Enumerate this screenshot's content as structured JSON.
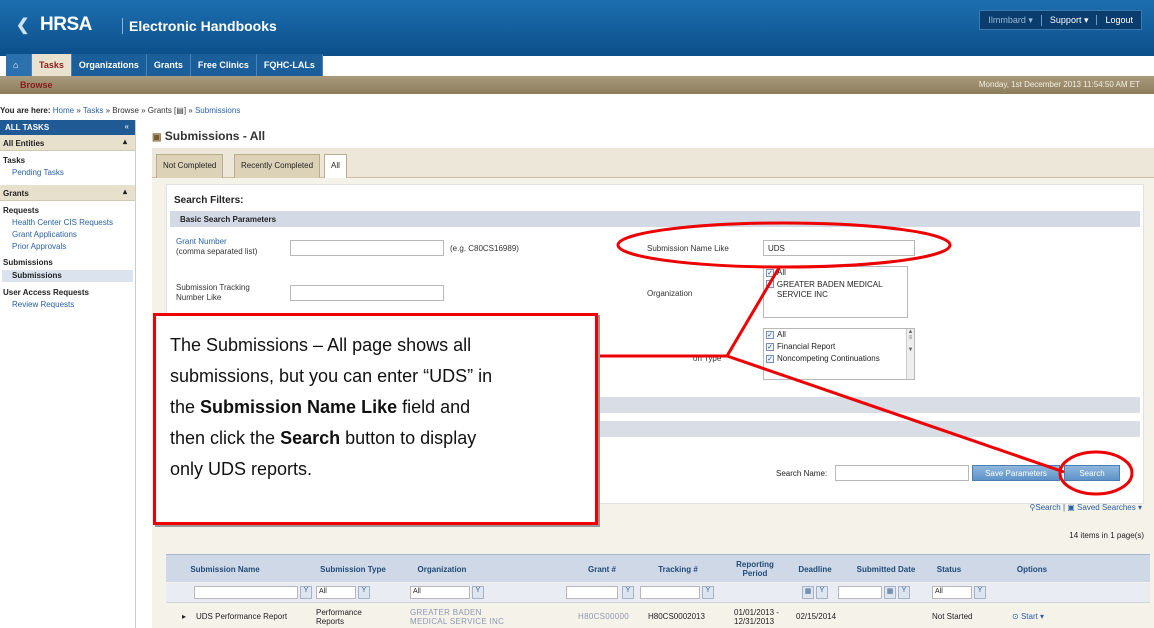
{
  "header": {
    "logo_text": "HRSA",
    "app_title": "Electronic Handbooks",
    "user_menu": "Ilmmbard ▾",
    "support": "Support ▾",
    "logout": "Logout",
    "nav_tabs": [
      "Tasks",
      "Organizations",
      "Grants",
      "Free Clinics",
      "FQHC-LALs"
    ],
    "subnav": "Browse",
    "datetime": "Monday, 1st December 2013 11:54:50 AM ET"
  },
  "breadcrumb": {
    "prefix": "You are here:",
    "home": "Home",
    "tasks": "Tasks",
    "rest": "» Browse » Grants [",
    "after": "] »",
    "submissions": "Submissions"
  },
  "sidebar": {
    "title": "ALL TASKS",
    "collapse": "«",
    "all_entities": "All Entities",
    "tasks_group": "Tasks",
    "pending_tasks": "Pending Tasks",
    "grants": "Grants",
    "requests_group": "Requests",
    "hc_cis": "Health Center CIS Requests",
    "grant_apps": "Grant Applications",
    "prior_approvals": "Prior Approvals",
    "submissions_group": "Submissions",
    "submissions_item": "Submissions",
    "user_access_group": "User Access Requests",
    "review_requests": "Review Requests"
  },
  "main": {
    "title": "Submissions - All",
    "tabs": [
      "Not Completed",
      "Recently Completed",
      "All"
    ],
    "filters_title": "Search Filters:",
    "basic_header": "Basic Search Parameters",
    "grant_number_label": "Grant Number",
    "grant_number_hint": "(comma separated list)",
    "grant_number_example": "(e.g. C80CS16989)",
    "tracking_label": "Submission Tracking Number Like",
    "name_like_label": "Submission Name Like",
    "name_like_value": "UDS",
    "organization_label": "Organization",
    "organization_options": [
      "All",
      "GREATER BADEN MEDICAL SERVICE INC"
    ],
    "type_label": "on Type",
    "type_options": [
      "All",
      "Financial Report",
      "Noncompeting Continuations"
    ],
    "search_name_label": "Search Name:",
    "save_params": "Save Parameters",
    "search_button": "Search",
    "search_tool": "Search",
    "saved_searches": "Saved Searches ▾",
    "items_count": "14 items in 1 page(s)"
  },
  "table": {
    "columns": [
      "Submission Name",
      "Submission Type",
      "Organization",
      "Grant #",
      "Tracking #",
      "Reporting Period",
      "Deadline",
      "Submitted Date",
      "Status",
      "Options"
    ],
    "filter_all": "All",
    "rows": [
      {
        "name": "UDS Performance Report",
        "type": "Performance Reports",
        "organization": "GREATER BADEN MEDICAL SERVICE INC",
        "grant": "H80CS00000",
        "tracking": "H80CS0002013",
        "period": "01/01/2013 - 12/31/2013",
        "deadline": "02/15/2014",
        "submitted": "",
        "status": "Not Started",
        "option": "Start ▾"
      }
    ]
  },
  "callout": {
    "line1": "The Submissions – All page shows all",
    "line2": "submissions, but you can enter “UDS” in",
    "line3_pre": "the ",
    "line3_bold": "Submission Name Like",
    "line3_post": " field and",
    "line4_pre": "then click the ",
    "line4_bold": "Search",
    "line4_post": " button to display",
    "line5": "only UDS reports."
  },
  "colors": {
    "header_blue": "#0b4f8a",
    "callout_red": "#ee0000",
    "link_blue": "#2a62a4"
  }
}
